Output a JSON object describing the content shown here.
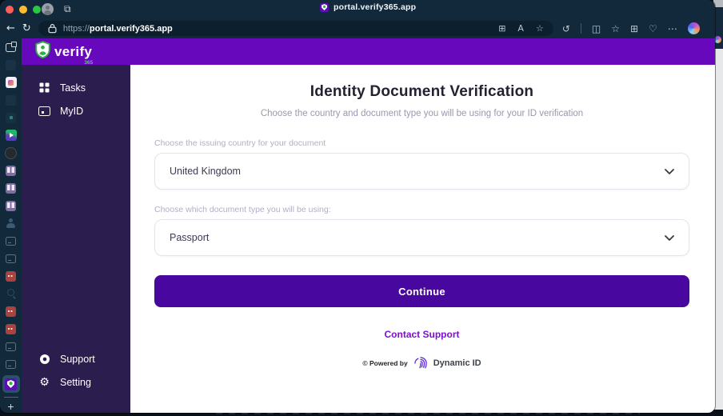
{
  "colors": {
    "toolbar_navy": "#12293c",
    "address_bar": "#0c1f2f",
    "header_purple": "#6708bd",
    "sidebar_purple": "#2b1d4e",
    "button_purple": "#48089f",
    "link_purple": "#7d10cf",
    "brand_green": "#35b44a",
    "favicon_purple": "#5c0fb0",
    "fingerprint_purple": "#5d2bd6",
    "page_bg": "#ffffff",
    "tl_red": "#ff5f57",
    "tl_yellow": "#febc2e",
    "tl_green": "#28c840"
  },
  "titlebar": {
    "tab_title": "portal.verify365.app"
  },
  "toolbar": {
    "back_glyph": "←",
    "refresh_glyph": "↻",
    "workspace_cube_glyph": "⧉",
    "url_scheme": "https://",
    "url_host": "portal.verify365.app",
    "address_icons": [
      {
        "name": "workspaces-icon",
        "glyph": "⊞"
      },
      {
        "name": "read-aloud-icon",
        "glyph": "A"
      },
      {
        "name": "add-favorite-icon",
        "glyph": "☆"
      }
    ],
    "right_icons": [
      {
        "name": "history-icon",
        "glyph": "↺"
      },
      {
        "name": "separator",
        "glyph": ""
      },
      {
        "name": "split-screen-icon",
        "glyph": "◫"
      },
      {
        "name": "collections-icon",
        "glyph": "☆"
      },
      {
        "name": "tab-groups-icon",
        "glyph": "⊞"
      },
      {
        "name": "browser-essentials-icon",
        "glyph": "♡"
      },
      {
        "name": "more-options-icon",
        "glyph": "⋯"
      },
      {
        "name": "copilot-icon",
        "glyph": ""
      }
    ]
  },
  "tabstrip": {
    "new_tab_glyph": "+",
    "icons": [
      {
        "name": "collapse-vertical-tabs-icon",
        "kind": "window-bright"
      },
      {
        "name": "tab-favicon",
        "kind": "faint"
      },
      {
        "name": "tab-favicon",
        "kind": "photo"
      },
      {
        "name": "tab-favicon",
        "kind": "faint"
      },
      {
        "name": "tab-favicon",
        "kind": "faint-teal"
      },
      {
        "name": "tab-favicon",
        "kind": "media"
      },
      {
        "name": "tab-favicon",
        "kind": "dark-circle"
      },
      {
        "name": "tab-favicon",
        "kind": "board"
      },
      {
        "name": "tab-favicon",
        "kind": "board"
      },
      {
        "name": "tab-favicon",
        "kind": "board"
      },
      {
        "name": "tab-favicon",
        "kind": "person"
      },
      {
        "name": "tab-favicon",
        "kind": "window-dim"
      },
      {
        "name": "tab-favicon",
        "kind": "window-dim"
      },
      {
        "name": "tab-favicon",
        "kind": "red"
      },
      {
        "name": "tab-favicon",
        "kind": "search"
      },
      {
        "name": "tab-favicon",
        "kind": "red"
      },
      {
        "name": "tab-favicon",
        "kind": "red"
      },
      {
        "name": "tab-favicon",
        "kind": "window-dim"
      },
      {
        "name": "tab-favicon",
        "kind": "window-dim"
      },
      {
        "name": "active-tab-verify365",
        "kind": "verify-active"
      }
    ]
  },
  "app": {
    "logo_word": "verify",
    "logo_suffix": "365",
    "sidebar": {
      "items": [
        {
          "label": "Tasks",
          "icon": "tasks"
        },
        {
          "label": "MyID",
          "icon": "myid"
        }
      ],
      "footer": [
        {
          "label": "Support",
          "icon": "support"
        },
        {
          "label": "Setting",
          "icon": "setting",
          "glyph": "⚙"
        }
      ]
    },
    "main": {
      "title": "Identity Document Verification",
      "subtitle": "Choose the country and document type you will be using for your ID verification",
      "country_label": "Choose the issuing country for your document",
      "country_value": "United Kingdom",
      "doctype_label": "Choose which document type you will be using:",
      "doctype_value": "Passport",
      "continue_label": "Continue",
      "support_link": "Contact Support",
      "powered_by_label": "© Powered by",
      "powered_by_brand": "Dynamic ID"
    }
  }
}
